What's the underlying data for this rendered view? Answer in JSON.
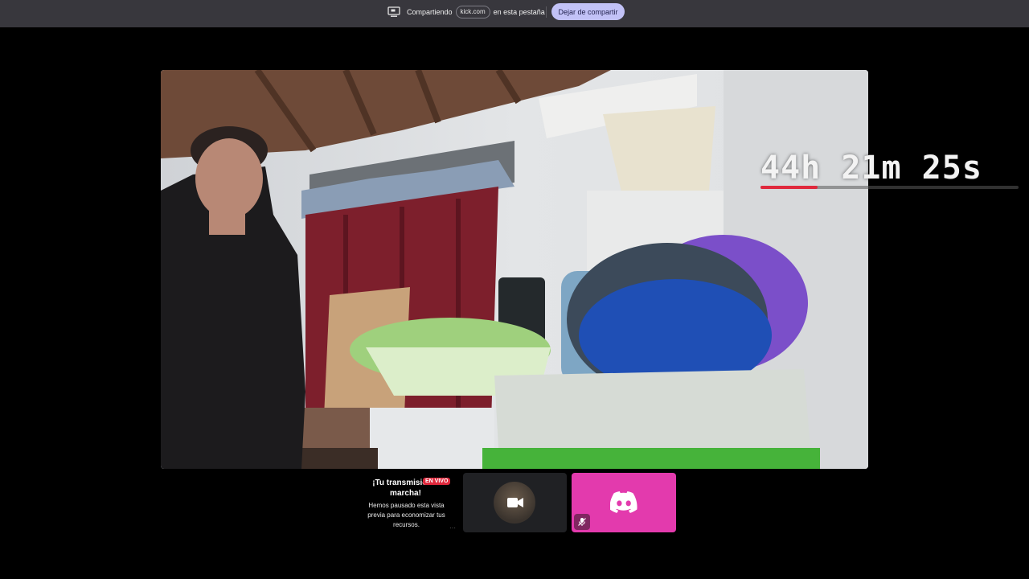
{
  "share_bar": {
    "sharing_label": "Compartiendo",
    "domain": "kick.com",
    "suffix": "en esta pestaña",
    "stop_button": "Dejar de compartir",
    "accent": "#c2c2f7"
  },
  "stream": {
    "timer": "44h 21m 25s",
    "timer_progress": 0.22,
    "progress_color": "#e0293d"
  },
  "tiles": {
    "preview": {
      "title": "¡Tu transmisión s marcha!",
      "live_badge": "EN VIVO",
      "body": "Hemos pausado esta vista previa para economizar tus recursos.",
      "more": "···"
    },
    "camera": {
      "icon": "video-camera-icon"
    },
    "discord": {
      "icon": "discord-icon",
      "mic_icon": "mic-muted-icon",
      "color": "#e33aad"
    }
  }
}
